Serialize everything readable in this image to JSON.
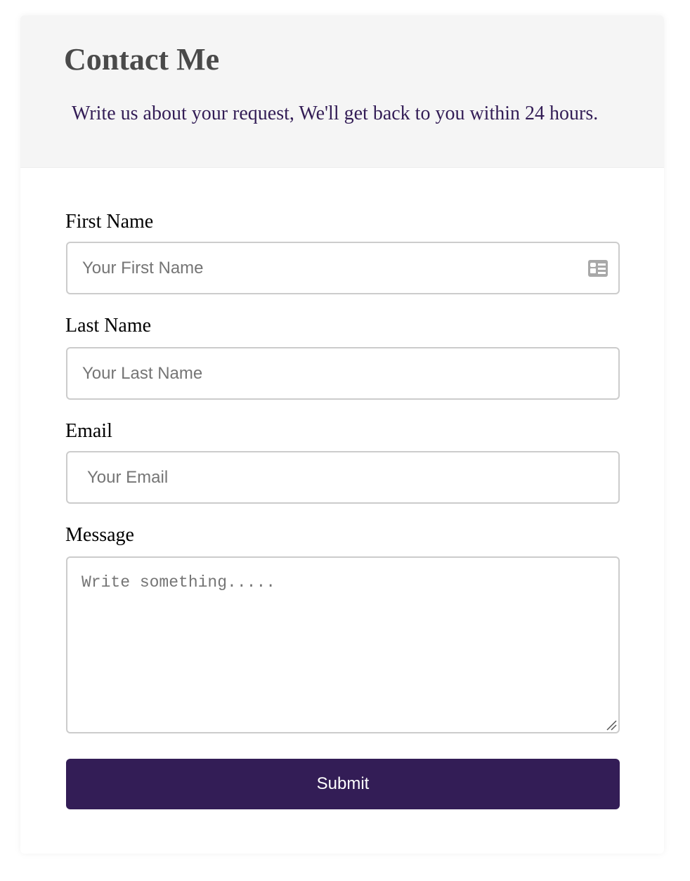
{
  "header": {
    "title": "Contact Me",
    "subtitle": "Write us about your request, We'll get back to you within 24 hours."
  },
  "form": {
    "first_name": {
      "label": "First Name",
      "placeholder": "Your First Name",
      "value": "",
      "icon": "contact-card-icon"
    },
    "last_name": {
      "label": "Last Name",
      "placeholder": "Your Last Name",
      "value": ""
    },
    "email": {
      "label": "Email",
      "placeholder": "Your Email",
      "value": ""
    },
    "message": {
      "label": "Message",
      "placeholder": "Write something.....",
      "value": ""
    },
    "submit_label": "Submit"
  },
  "colors": {
    "accent": "#331d56",
    "header_background": "#f5f5f5",
    "title_text": "#4a4a4a",
    "field_border": "#cccccc"
  }
}
